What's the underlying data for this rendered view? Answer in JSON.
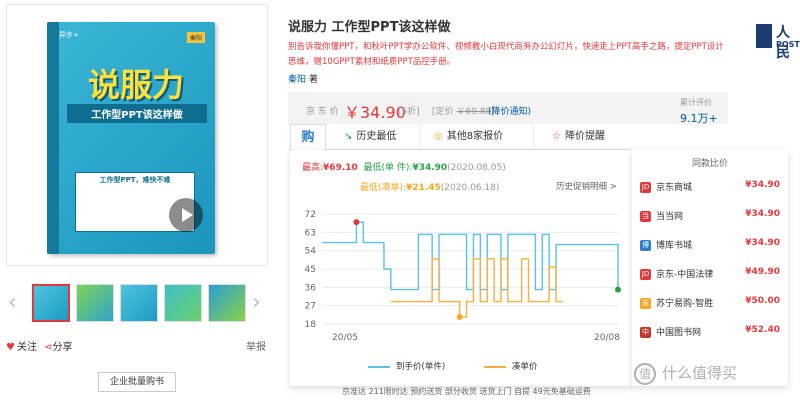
{
  "book": {
    "title": "说服力",
    "subtitle": "工作型PPT该这样做",
    "card_title": "工作型PPT，难快不难",
    "publisher_logo": "异步+"
  },
  "gallery": {
    "follow": "关注",
    "share": "分享",
    "report": "举报",
    "bulk": "企业批量购书"
  },
  "product": {
    "title": "说服力 工作型PPT该这样做",
    "promo": "别告诉我你懂PPT，和秋叶PPT学办公软件、视频教小白现代商务办公幻灯片，快速走上PPT高手之路，提定PPT设计思维，赠10GPPT素材和纸质PPT品控手册。",
    "author_name": "秦阳",
    "author_suffix": "著"
  },
  "brand": {
    "name": "人民",
    "sub": "POST"
  },
  "price": {
    "label": "京 东 价",
    "value": "￥34.90",
    "discount": "[5折]",
    "list_label": "[定价",
    "list_value": "￥69.80",
    "list_close": "]",
    "notify": "(降价通知)",
    "review_label": "累计评价",
    "review_value": "9.1万+"
  },
  "tabs": [
    {
      "icon": "购",
      "label": ""
    },
    {
      "icon": "↘",
      "label": "历史最低"
    },
    {
      "icon": "◎",
      "label": "其他8家报价"
    },
    {
      "icon": "☆",
      "label": "降价提醒"
    }
  ],
  "history": {
    "high_label": "最高:",
    "high_value": "¥69.10",
    "low_label": "最低(单 件):",
    "low_value": "¥34.90",
    "low_date": "(2020.08.05)",
    "low2_label": "最低(凑单):",
    "low2_value": "¥21.45",
    "low2_date": "(2020.06.18)",
    "link": "历史促销明细 >"
  },
  "legend": {
    "a": "到手价(单件)",
    "b": "凑单价"
  },
  "colors": {
    "line_a": "#5bc0eb",
    "line_b": "#f5b041",
    "accent": "#e4393c"
  },
  "chart_data": {
    "type": "line",
    "yticks": [
      18,
      27,
      36,
      45,
      54,
      63,
      72
    ],
    "ylim": [
      18,
      72
    ],
    "xlabels": [
      "20/05",
      "20/08"
    ],
    "series": [
      {
        "name": "到手价(单件)",
        "values": [
          58,
          58,
          58,
          58,
          58,
          68,
          58,
          58,
          58,
          45,
          34.9,
          34.9,
          34.9,
          34.9,
          62,
          62,
          34.9,
          62,
          62,
          62,
          62,
          34.9,
          62,
          34.9,
          62,
          62,
          34.9,
          62,
          62,
          62,
          62,
          34.9,
          62,
          34.9,
          57,
          57,
          57,
          57,
          57,
          57,
          57,
          57,
          57,
          34.9
        ]
      },
      {
        "name": "凑单价",
        "values": [
          null,
          null,
          null,
          null,
          null,
          null,
          null,
          null,
          null,
          null,
          29,
          29,
          29,
          29,
          29,
          29,
          50,
          29,
          29,
          29,
          21.45,
          29,
          50,
          29,
          50,
          29,
          50,
          29,
          29,
          50,
          29,
          29,
          29,
          46,
          29,
          29,
          null,
          null,
          null,
          null,
          null,
          null,
          null,
          null
        ]
      }
    ]
  },
  "compare": {
    "title": "同款比价",
    "rows": [
      {
        "icon": "JD",
        "color": "#e4393c",
        "name": "京东商城",
        "price": "¥34.90"
      },
      {
        "icon": "当",
        "color": "#e4393c",
        "name": "当当网",
        "price": "¥34.90"
      },
      {
        "icon": "博",
        "color": "#2c7fc8",
        "name": "博库书城",
        "price": "¥34.90"
      },
      {
        "icon": "JD",
        "color": "#e4393c",
        "name": "京东-中国法律",
        "price": "¥49.90"
      },
      {
        "icon": "苏",
        "color": "#f5a623",
        "name": "苏宁易购-智胜",
        "price": "¥50.00"
      },
      {
        "icon": "中",
        "color": "#c0392b",
        "name": "中国图书网",
        "price": "¥52.40"
      }
    ]
  },
  "footer": "京准达  211限时达  预约送货  部分收货  送货上门  自提  49元免基础运费",
  "watermark": "什么值得买"
}
